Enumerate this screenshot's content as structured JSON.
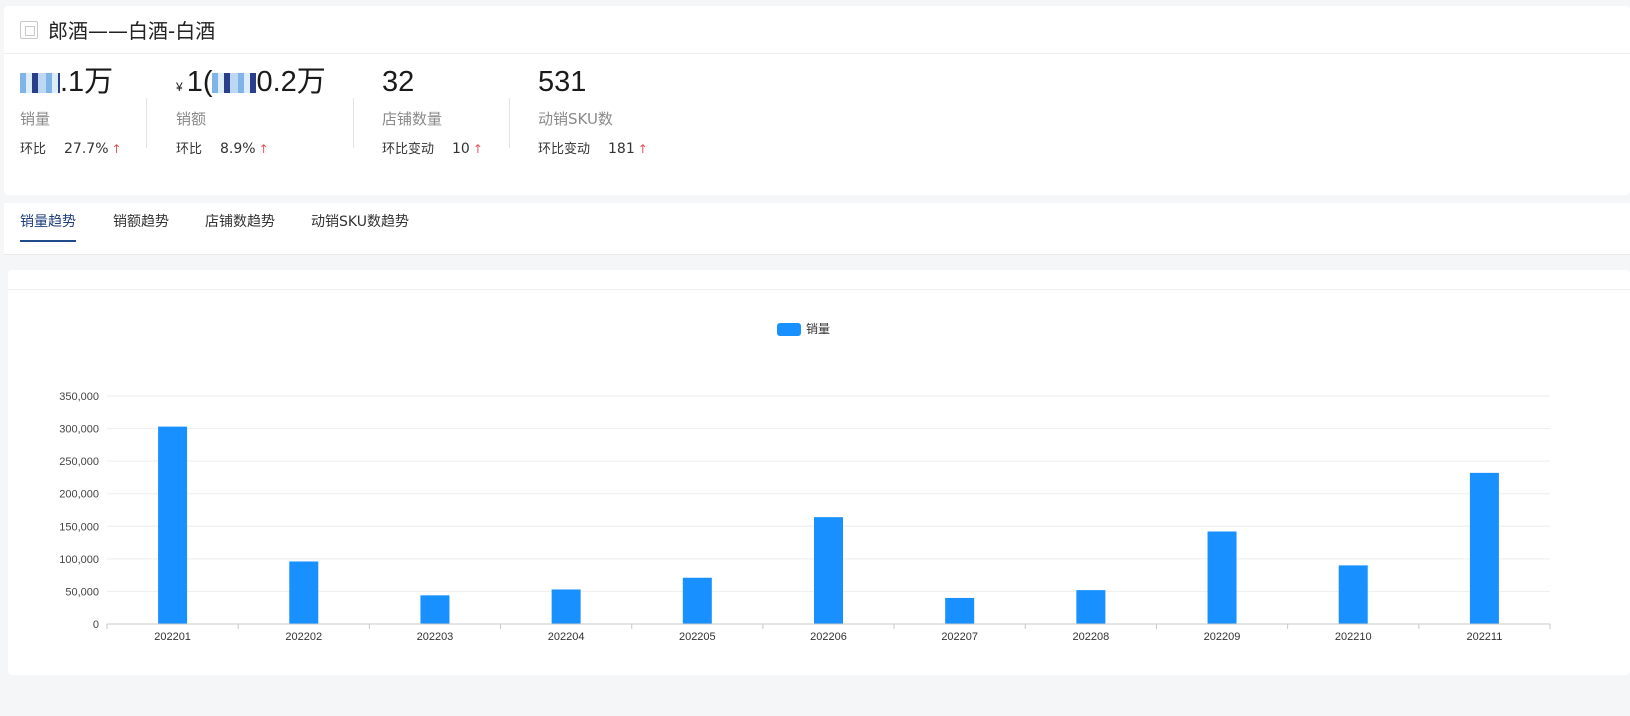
{
  "header": {
    "title": "郎酒——白酒-白酒"
  },
  "metrics": [
    {
      "value_suffix": ".1万",
      "label": "销量",
      "change_label": "环比",
      "change_value": "27.7%"
    },
    {
      "currency": "¥",
      "value_prefix": "1(",
      "value_suffix": "0.2万",
      "label": "销额",
      "change_label": "环比",
      "change_value": "8.9%"
    },
    {
      "value": "32",
      "label": "店铺数量",
      "change_label": "环比变动",
      "change_value": "10"
    },
    {
      "value": "531",
      "label": "动销SKU数",
      "change_label": "环比变动",
      "change_value": "181"
    }
  ],
  "tabs": [
    {
      "label": "销量趋势",
      "active": true
    },
    {
      "label": "销额趋势",
      "active": false
    },
    {
      "label": "店铺数趋势",
      "active": false
    },
    {
      "label": "动销SKU数趋势",
      "active": false
    }
  ],
  "colors": {
    "bar": "#1890ff",
    "up_arrow": "#e05454",
    "tab_active": "#1f4a8c"
  },
  "chart_data": {
    "type": "bar",
    "categories": [
      "202201",
      "202202",
      "202203",
      "202204",
      "202205",
      "202206",
      "202207",
      "202208",
      "202209",
      "202210",
      "202211"
    ],
    "series": [
      {
        "name": "销量",
        "values": [
          303000,
          96000,
          44000,
          53000,
          71000,
          164000,
          40000,
          52000,
          142000,
          90000,
          232000
        ]
      }
    ],
    "ylim": [
      0,
      350000
    ],
    "yticks": [
      "0",
      "50,000",
      "100,000",
      "150,000",
      "200,000",
      "250,000",
      "300,000",
      "350,000"
    ],
    "ytick_values": [
      0,
      50000,
      100000,
      150000,
      200000,
      250000,
      300000,
      350000
    ],
    "legend_position": "top-center",
    "grid": true
  }
}
